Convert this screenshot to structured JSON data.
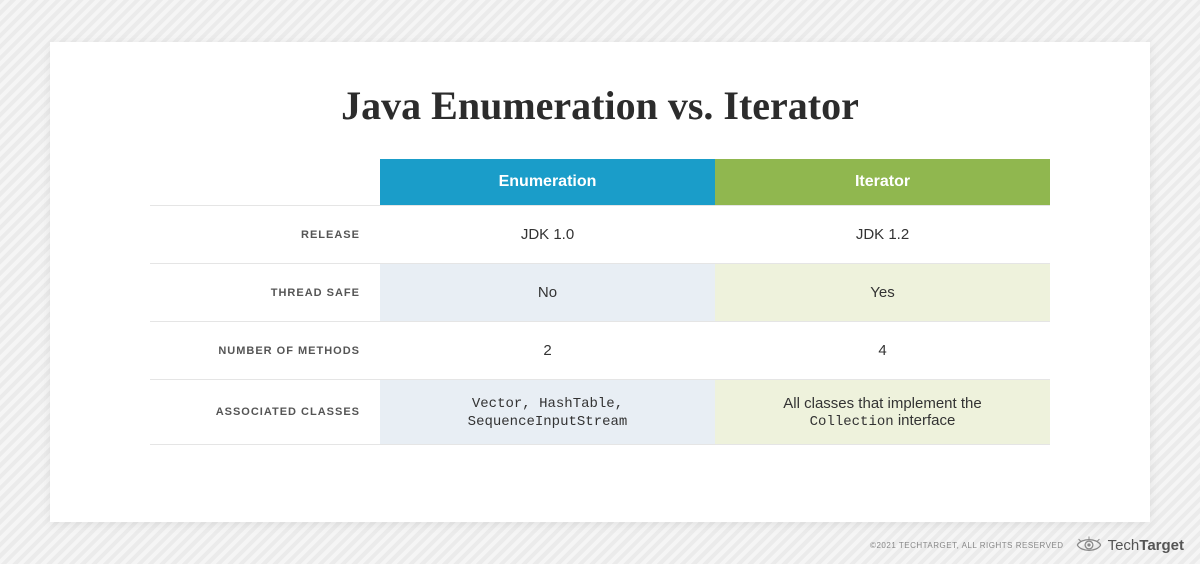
{
  "title": "Java Enumeration vs. Iterator",
  "columns": {
    "enumeration": "Enumeration",
    "iterator": "Iterator"
  },
  "rows": {
    "release": {
      "label": "RELEASE",
      "enumeration": "JDK 1.0",
      "iterator": "JDK 1.2"
    },
    "threadsafe": {
      "label": "THREAD SAFE",
      "enumeration": "No",
      "iterator": "Yes"
    },
    "methods": {
      "label": "NUMBER OF METHODS",
      "enumeration": "2",
      "iterator": "4"
    },
    "classes": {
      "label": "ASSOCIATED CLASSES",
      "enumeration_line1": "Vector, HashTable,",
      "enumeration_line2": "SequenceInputStream",
      "iterator_line1": "All classes that implement the",
      "iterator_code": "Collection",
      "iterator_suffix": " interface"
    }
  },
  "footer": {
    "copyright": "©2021 TECHTARGET, ALL RIGHTS RESERVED",
    "brand_light": "Tech",
    "brand_bold": "Target"
  },
  "chart_data": {
    "type": "table",
    "title": "Java Enumeration vs. Iterator",
    "columns": [
      "Enumeration",
      "Iterator"
    ],
    "rows": [
      {
        "metric": "RELEASE",
        "Enumeration": "JDK 1.0",
        "Iterator": "JDK 1.2"
      },
      {
        "metric": "THREAD SAFE",
        "Enumeration": "No",
        "Iterator": "Yes"
      },
      {
        "metric": "NUMBER OF METHODS",
        "Enumeration": 2,
        "Iterator": 4
      },
      {
        "metric": "ASSOCIATED CLASSES",
        "Enumeration": "Vector, HashTable, SequenceInputStream",
        "Iterator": "All classes that implement the Collection interface"
      }
    ]
  }
}
